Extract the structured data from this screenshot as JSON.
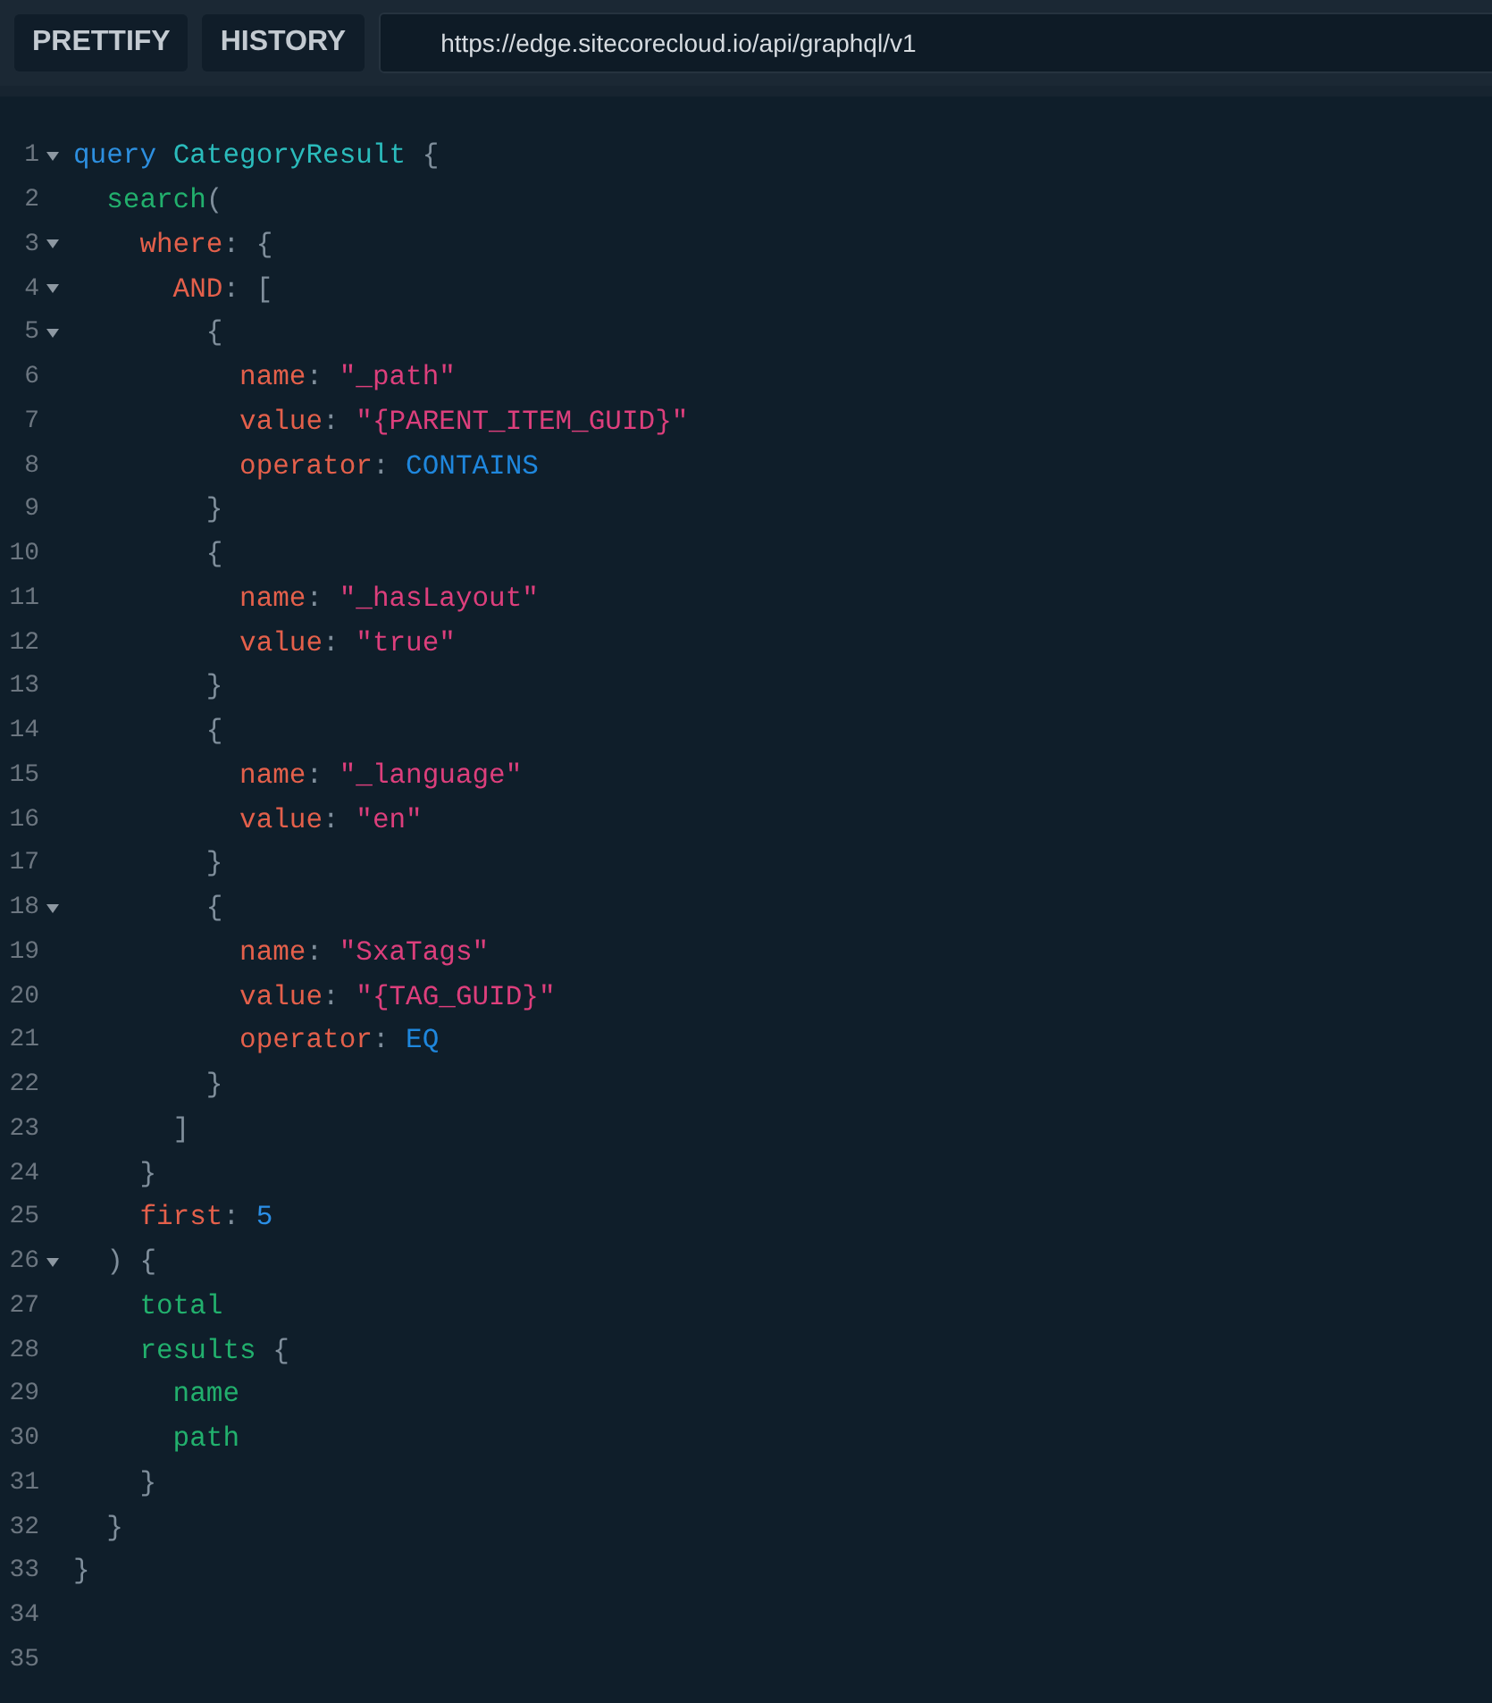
{
  "toolbar": {
    "buttons": [
      "PRETTIFY",
      "HISTORY"
    ],
    "url_field": {
      "value": "https://edge.sitecorecloud.io/api/graphql/v1"
    }
  },
  "editor": {
    "lines": [
      {
        "number": "1",
        "foldable": true,
        "tokens": [
          {
            "kind": "keyword",
            "text": "query"
          },
          {
            "kind": "type",
            "text": " CategoryResult"
          },
          {
            "kind": "punct",
            "text": " {"
          }
        ]
      },
      {
        "number": "2",
        "foldable": false,
        "tokens": [
          {
            "kind": "field",
            "text": "  search"
          },
          {
            "kind": "punct",
            "text": "("
          }
        ]
      },
      {
        "number": "3",
        "foldable": true,
        "tokens": [
          {
            "kind": "argument",
            "text": "    where"
          },
          {
            "kind": "punct",
            "text": ": {"
          }
        ]
      },
      {
        "number": "4",
        "foldable": true,
        "tokens": [
          {
            "kind": "argument",
            "text": "      AND"
          },
          {
            "kind": "punct",
            "text": ": ["
          }
        ]
      },
      {
        "number": "5",
        "foldable": true,
        "tokens": [
          {
            "kind": "punct",
            "text": "        {"
          }
        ]
      },
      {
        "number": "6",
        "foldable": false,
        "tokens": [
          {
            "kind": "argument",
            "text": "          name"
          },
          {
            "kind": "punct",
            "text": ": "
          },
          {
            "kind": "string",
            "text": "\"_path\""
          }
        ]
      },
      {
        "number": "7",
        "foldable": false,
        "tokens": [
          {
            "kind": "argument",
            "text": "          value"
          },
          {
            "kind": "punct",
            "text": ": "
          },
          {
            "kind": "string",
            "text": "\"{PARENT_ITEM_GUID}\""
          }
        ]
      },
      {
        "number": "8",
        "foldable": false,
        "tokens": [
          {
            "kind": "argument",
            "text": "          operator"
          },
          {
            "kind": "punct",
            "text": ": "
          },
          {
            "kind": "enum",
            "text": "CONTAINS"
          }
        ]
      },
      {
        "number": "9",
        "foldable": false,
        "tokens": [
          {
            "kind": "punct",
            "text": "        }"
          }
        ]
      },
      {
        "number": "10",
        "foldable": false,
        "tokens": [
          {
            "kind": "punct",
            "text": "        {"
          }
        ]
      },
      {
        "number": "11",
        "foldable": false,
        "tokens": [
          {
            "kind": "argument",
            "text": "          name"
          },
          {
            "kind": "punct",
            "text": ": "
          },
          {
            "kind": "string",
            "text": "\"_hasLayout\""
          }
        ]
      },
      {
        "number": "12",
        "foldable": false,
        "tokens": [
          {
            "kind": "argument",
            "text": "          value"
          },
          {
            "kind": "punct",
            "text": ": "
          },
          {
            "kind": "string",
            "text": "\"true\""
          }
        ]
      },
      {
        "number": "13",
        "foldable": false,
        "tokens": [
          {
            "kind": "punct",
            "text": "        }"
          }
        ]
      },
      {
        "number": "14",
        "foldable": false,
        "tokens": [
          {
            "kind": "punct",
            "text": "        {"
          }
        ]
      },
      {
        "number": "15",
        "foldable": false,
        "tokens": [
          {
            "kind": "argument",
            "text": "          name"
          },
          {
            "kind": "punct",
            "text": ": "
          },
          {
            "kind": "string",
            "text": "\"_language\""
          }
        ]
      },
      {
        "number": "16",
        "foldable": false,
        "tokens": [
          {
            "kind": "argument",
            "text": "          value"
          },
          {
            "kind": "punct",
            "text": ": "
          },
          {
            "kind": "string",
            "text": "\"en\""
          }
        ]
      },
      {
        "number": "17",
        "foldable": false,
        "tokens": [
          {
            "kind": "punct",
            "text": "        }"
          }
        ]
      },
      {
        "number": "18",
        "foldable": true,
        "tokens": [
          {
            "kind": "punct",
            "text": "        {"
          }
        ]
      },
      {
        "number": "19",
        "foldable": false,
        "tokens": [
          {
            "kind": "argument",
            "text": "          name"
          },
          {
            "kind": "punct",
            "text": ": "
          },
          {
            "kind": "string",
            "text": "\"SxaTags\""
          }
        ]
      },
      {
        "number": "20",
        "foldable": false,
        "tokens": [
          {
            "kind": "argument",
            "text": "          value"
          },
          {
            "kind": "punct",
            "text": ": "
          },
          {
            "kind": "string",
            "text": "\"{TAG_GUID}\""
          }
        ]
      },
      {
        "number": "21",
        "foldable": false,
        "tokens": [
          {
            "kind": "argument",
            "text": "          operator"
          },
          {
            "kind": "punct",
            "text": ": "
          },
          {
            "kind": "enum",
            "text": "EQ"
          }
        ]
      },
      {
        "number": "22",
        "foldable": false,
        "tokens": [
          {
            "kind": "punct",
            "text": "        }"
          }
        ]
      },
      {
        "number": "23",
        "foldable": false,
        "tokens": [
          {
            "kind": "punct",
            "text": "      ]"
          }
        ]
      },
      {
        "number": "24",
        "foldable": false,
        "tokens": [
          {
            "kind": "punct",
            "text": "    }"
          }
        ]
      },
      {
        "number": "25",
        "foldable": false,
        "tokens": [
          {
            "kind": "argument",
            "text": "    first"
          },
          {
            "kind": "punct",
            "text": ": "
          },
          {
            "kind": "number",
            "text": "5"
          }
        ]
      },
      {
        "number": "26",
        "foldable": true,
        "tokens": [
          {
            "kind": "punct",
            "text": "  ) {"
          }
        ]
      },
      {
        "number": "27",
        "foldable": false,
        "tokens": [
          {
            "kind": "field",
            "text": "    total"
          }
        ]
      },
      {
        "number": "28",
        "foldable": false,
        "tokens": [
          {
            "kind": "field",
            "text": "    results"
          },
          {
            "kind": "punct",
            "text": " {"
          }
        ]
      },
      {
        "number": "29",
        "foldable": false,
        "tokens": [
          {
            "kind": "field",
            "text": "      name"
          }
        ]
      },
      {
        "number": "30",
        "foldable": false,
        "tokens": [
          {
            "kind": "field",
            "text": "      path"
          }
        ]
      },
      {
        "number": "31",
        "foldable": false,
        "tokens": [
          {
            "kind": "punct",
            "text": "    }"
          }
        ]
      },
      {
        "number": "32",
        "foldable": false,
        "tokens": [
          {
            "kind": "punct",
            "text": "  }"
          }
        ]
      },
      {
        "number": "33",
        "foldable": false,
        "tokens": [
          {
            "kind": "punct",
            "text": "}"
          }
        ]
      },
      {
        "number": "34",
        "foldable": false
      },
      {
        "number": "35",
        "foldable": false
      }
    ]
  }
}
